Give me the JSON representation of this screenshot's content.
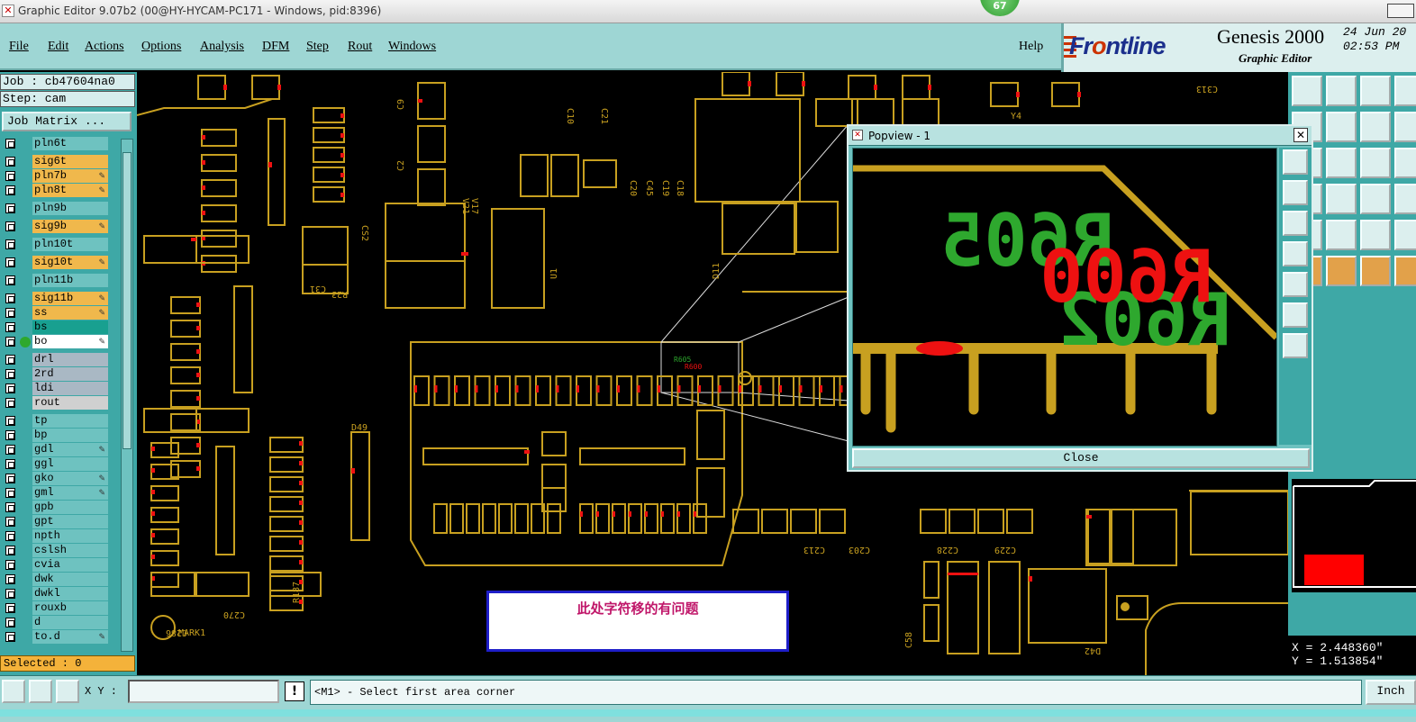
{
  "window": {
    "title": "Graphic Editor 9.07b2 (00@HY-HYCAM-PC171 - Windows, pid:8396)",
    "badge": "67"
  },
  "menu": {
    "items": [
      "File",
      "Edit",
      "Actions",
      "Options",
      "Analysis",
      "DFM",
      "Step",
      "Rout",
      "Windows"
    ],
    "help": "Help"
  },
  "brand": {
    "logo_prefix": "Fr",
    "logo_o": "o",
    "logo_suffix": "ntline",
    "product": "Genesis 2000",
    "subtitle": "Graphic Editor",
    "date": "24 Jun 20",
    "time": "02:53 PM"
  },
  "job": {
    "job_label": "Job : cb47604na0",
    "step_label": "Step: cam",
    "matrix_button": "Job Matrix ..."
  },
  "layers": [
    {
      "name": "pln6t",
      "color": "#6ec2c0",
      "mark": ""
    },
    {
      "name": "sig6t",
      "color": "#f0b84c",
      "mark": ""
    },
    {
      "name": "pln7b",
      "color": "#f0b84c",
      "mark": "✎"
    },
    {
      "name": "pln8t",
      "color": "#f0b84c",
      "mark": "✎"
    },
    {
      "name": "pln9b",
      "color": "#6ec2c0",
      "mark": ""
    },
    {
      "name": "sig9b",
      "color": "#f0b84c",
      "mark": "✎"
    },
    {
      "name": "pln10t",
      "color": "#6ec2c0",
      "mark": ""
    },
    {
      "name": "sig10t",
      "color": "#f0b84c",
      "mark": "✎"
    },
    {
      "name": "pln11b",
      "color": "#6ec2c0",
      "mark": ""
    },
    {
      "name": "sig11b",
      "color": "#f0b84c",
      "mark": "✎"
    },
    {
      "name": "ss",
      "color": "#f0b84c",
      "mark": "✎"
    },
    {
      "name": "bs",
      "color": "#18a090",
      "mark": ""
    },
    {
      "name": "bo",
      "color": "#ffffff",
      "mark": "✎",
      "dot": true
    },
    {
      "name": "drl",
      "color": "#a9b8c4",
      "mark": ""
    },
    {
      "name": "2rd",
      "color": "#a9b8c4",
      "mark": ""
    },
    {
      "name": "ldi",
      "color": "#a9b8c4",
      "mark": ""
    },
    {
      "name": "rout",
      "color": "#d0d0d0",
      "mark": ""
    },
    {
      "name": "tp",
      "color": "#6ec2c0",
      "mark": ""
    },
    {
      "name": "bp",
      "color": "#6ec2c0",
      "mark": ""
    },
    {
      "name": "gdl",
      "color": "#6ec2c0",
      "mark": "✎"
    },
    {
      "name": "ggl",
      "color": "#6ec2c0",
      "mark": ""
    },
    {
      "name": "gko",
      "color": "#6ec2c0",
      "mark": "✎"
    },
    {
      "name": "gml",
      "color": "#6ec2c0",
      "mark": "✎"
    },
    {
      "name": "gpb",
      "color": "#6ec2c0",
      "mark": ""
    },
    {
      "name": "gpt",
      "color": "#6ec2c0",
      "mark": ""
    },
    {
      "name": "npth",
      "color": "#6ec2c0",
      "mark": ""
    },
    {
      "name": "cslsh",
      "color": "#6ec2c0",
      "mark": ""
    },
    {
      "name": "cvia",
      "color": "#6ec2c0",
      "mark": ""
    },
    {
      "name": "dwk",
      "color": "#6ec2c0",
      "mark": ""
    },
    {
      "name": "dwkl",
      "color": "#6ec2c0",
      "mark": ""
    },
    {
      "name": "rouxb",
      "color": "#6ec2c0",
      "mark": ""
    },
    {
      "name": "d",
      "color": "#6ec2c0",
      "mark": ""
    },
    {
      "name": "to.d",
      "color": "#6ec2c0",
      "mark": "✎"
    }
  ],
  "selected": "Selected : 0",
  "popview": {
    "title": "Popview - 1",
    "close_label": "Close",
    "zoom_texts": [
      "R605",
      "R602",
      "R600"
    ]
  },
  "board_labels": [
    "C9",
    "C2",
    "C10",
    "C21",
    "C20",
    "C45",
    "C19",
    "C18",
    "V21",
    "V17",
    "CS2",
    "C31",
    "U1",
    "D11",
    "D49",
    "R23",
    "C286",
    "C270",
    "R187",
    "MARK1",
    "C213",
    "C203",
    "C228",
    "C229",
    "D42",
    "C58",
    "Y4",
    "C313"
  ],
  "note": "此处字符移的有问题",
  "coords": {
    "x": "X = 2.448360\"",
    "y": "Y = 1.513854\""
  },
  "statusbar": {
    "xy_label": "X Y :",
    "xy_value": "",
    "prompt": "<M1> - Select first area corner",
    "unit": "Inch"
  },
  "colors": {
    "panel": "#9ed6d4",
    "copper": "#c8a020",
    "pad": "#e11",
    "silk_green": "#2ea82e"
  }
}
